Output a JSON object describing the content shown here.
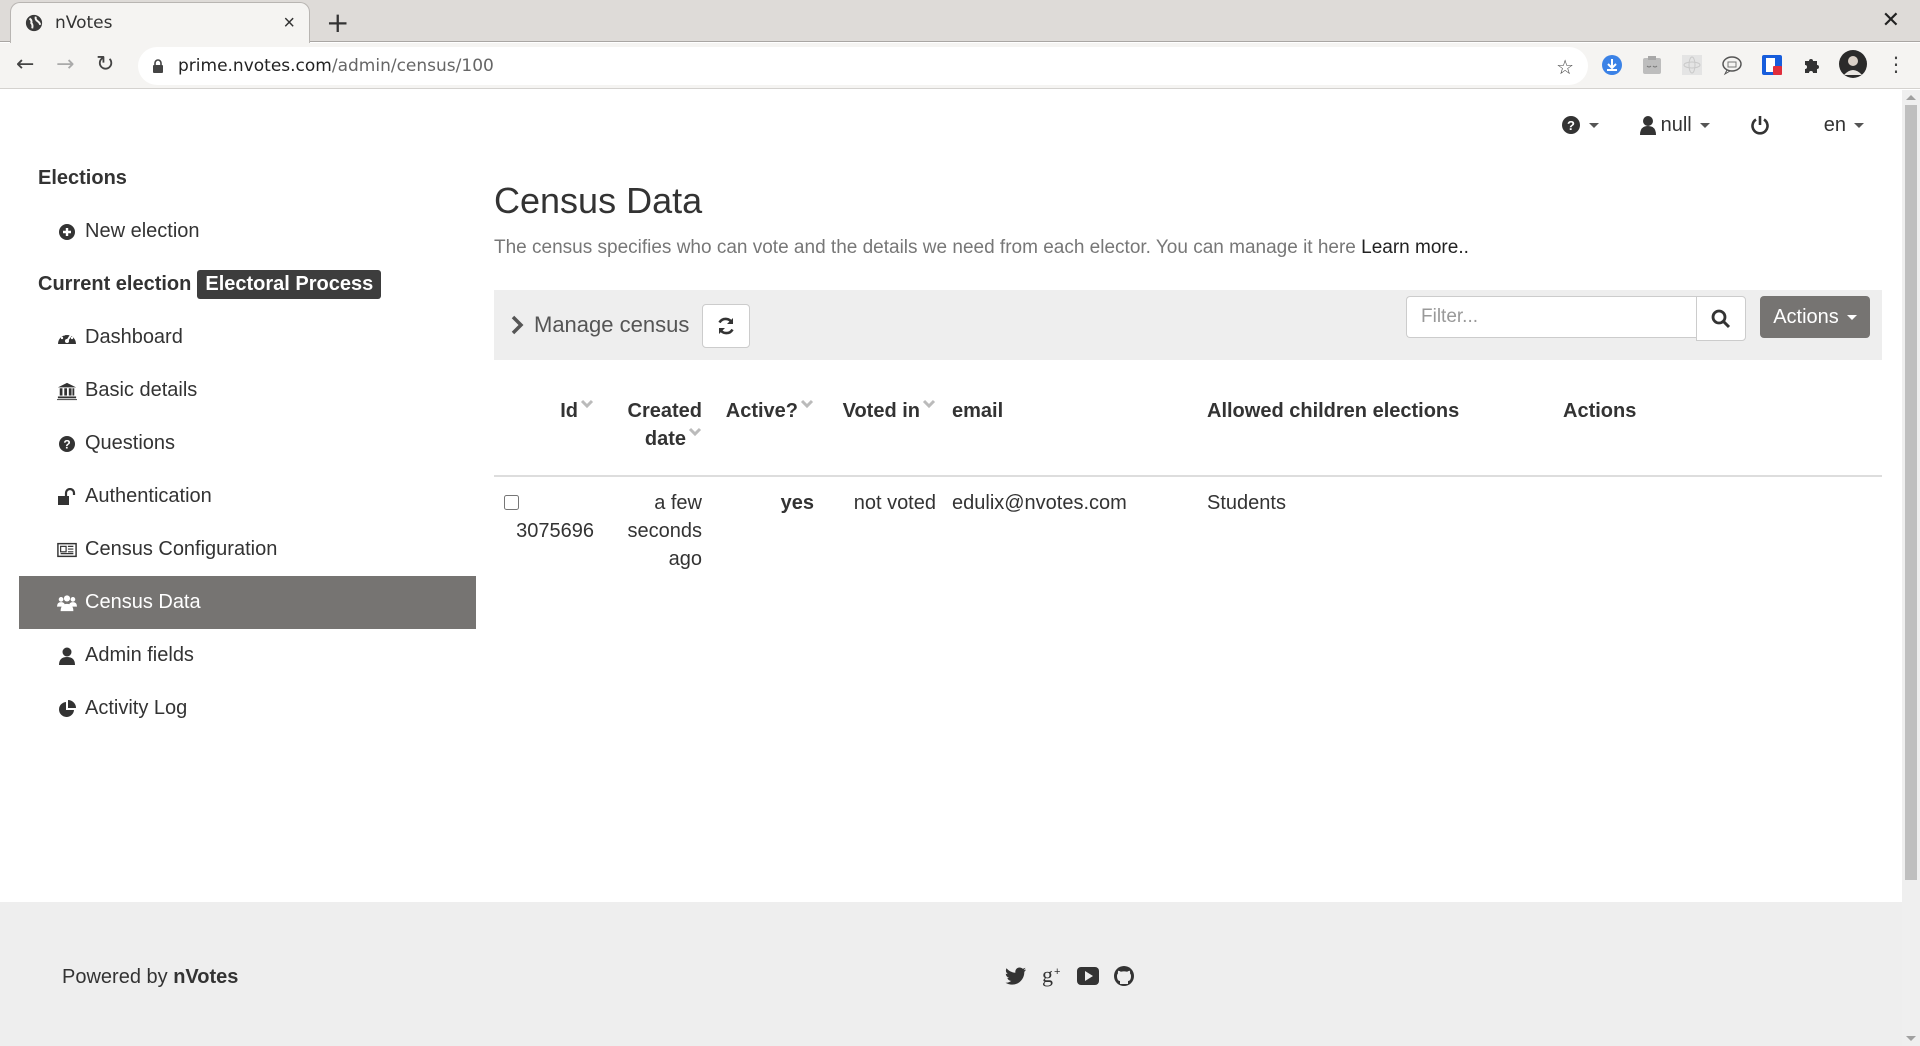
{
  "browser": {
    "tab_title": "nVotes",
    "tab_close": "×",
    "new_tab": "+",
    "window_close": "✕",
    "url_host": "prime.nvotes.com",
    "url_path": "/admin/census/100",
    "back": "←",
    "forward": "→",
    "reload": "↻",
    "star": "☆",
    "menu": "⋮"
  },
  "topnav": {
    "help_icon": "question-circle-icon",
    "user_label": "null",
    "power_icon": "power-icon",
    "language": "en"
  },
  "sidebar": {
    "elections_heading": "Elections",
    "new_election": "New election",
    "current_election_label": "Current election",
    "current_election_name": "Electoral Process",
    "items": [
      {
        "label": "Dashboard",
        "icon": "dashboard-icon",
        "active": false
      },
      {
        "label": "Basic details",
        "icon": "bank-icon",
        "active": false
      },
      {
        "label": "Questions",
        "icon": "question-circle-icon",
        "active": false
      },
      {
        "label": "Authentication",
        "icon": "unlock-icon",
        "active": false
      },
      {
        "label": "Census Configuration",
        "icon": "newspaper-icon",
        "active": false
      },
      {
        "label": "Census Data",
        "icon": "users-icon",
        "active": true
      },
      {
        "label": "Admin fields",
        "icon": "user-icon",
        "active": false
      },
      {
        "label": "Activity Log",
        "icon": "pie-chart-icon",
        "active": false
      }
    ]
  },
  "main": {
    "title": "Census Data",
    "description": "The census specifies who can vote and the details we need from each elector. You can manage it here",
    "learn_more": "Learn more..",
    "manage_census": "Manage census",
    "filter_placeholder": "Filter...",
    "filter_value": "",
    "actions_label": "Actions",
    "table": {
      "columns": [
        "Id",
        "Created date",
        "Active?",
        "Voted in",
        "email",
        "Allowed children elections",
        "Actions"
      ],
      "column_lines": {
        "created_1": "Created",
        "created_2": "date"
      },
      "rows": [
        {
          "checked": false,
          "id": "3075696",
          "created_1": "a few",
          "created_2": "seconds",
          "created_3": "ago",
          "active": "yes",
          "voted_in": "not voted",
          "email": "edulix@nvotes.com",
          "allowed_children": "Students",
          "actions": ""
        }
      ]
    }
  },
  "footer": {
    "powered_by": "Powered by",
    "brand": "nVotes",
    "social": [
      "twitter-icon",
      "google-plus-icon",
      "youtube-icon",
      "github-icon"
    ]
  },
  "colors": {
    "active_item_bg": "#767472",
    "badge_bg": "#3d3d3d",
    "manage_bar_bg": "#eeeeee",
    "footer_bg": "#eeeeee"
  }
}
